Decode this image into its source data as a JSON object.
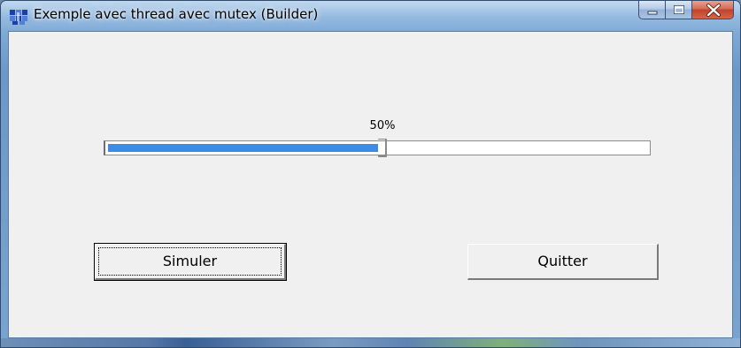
{
  "window": {
    "title": "Exemple avec thread avec mutex (Builder)"
  },
  "icons": {
    "app": "app-icon",
    "minimize": "minimize-icon",
    "maximize": "maximize-icon",
    "close": "close-icon"
  },
  "progress": {
    "label": "50%",
    "value": 0.5
  },
  "buttons": {
    "simulate_label": "Simuler",
    "quit_label": "Quitter"
  },
  "colors": {
    "progress_fill": "#3c8ce6",
    "close_button": "#c2412a"
  }
}
